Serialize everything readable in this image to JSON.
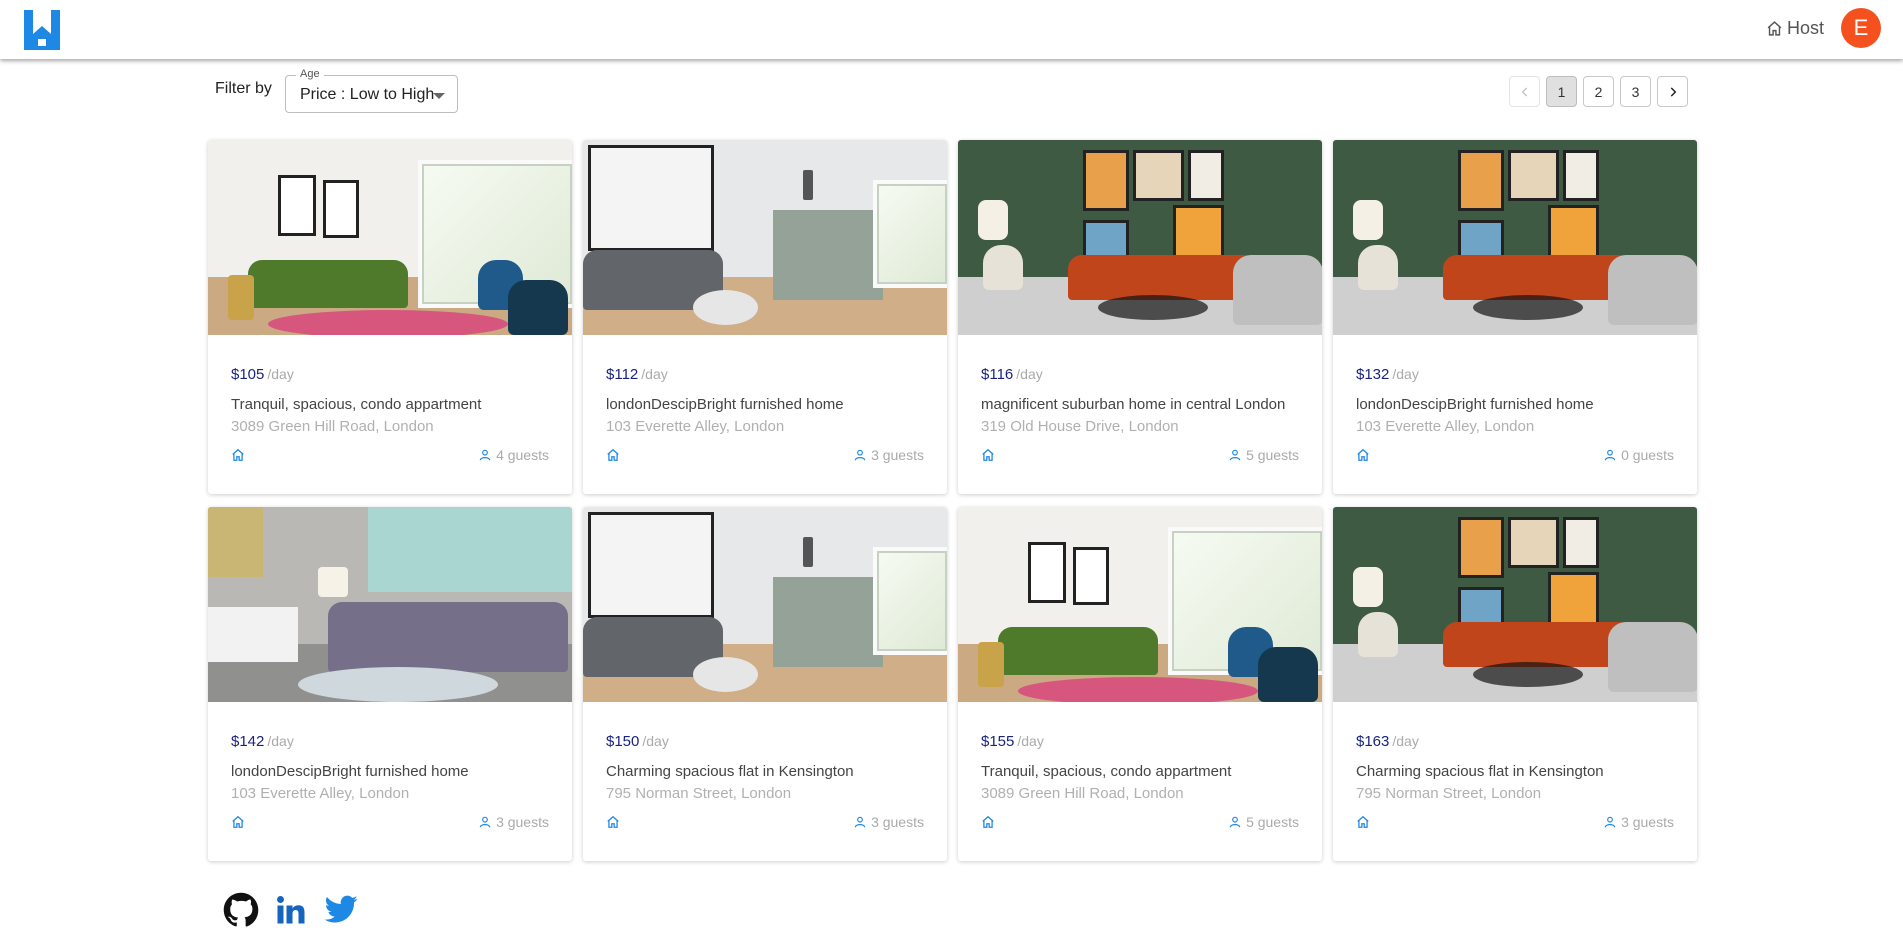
{
  "header": {
    "host_label": "Host",
    "avatar_initial": "E"
  },
  "filter": {
    "label": "Filter by",
    "legend": "Age",
    "value": "Price : Low to High"
  },
  "pagination": {
    "pages": [
      "1",
      "2",
      "3"
    ],
    "current": "1"
  },
  "listings": [
    {
      "price": "$105",
      "per": "/day",
      "title": "Tranquil, spacious, condo appartment",
      "address": "3089 Green Hill Road, London",
      "guests": "4 guests",
      "image": "green-sofa-room"
    },
    {
      "price": "$112",
      "per": "/day",
      "title": "londonDescipBright furnished home",
      "address": "103 Everette Alley, London",
      "guests": "3 guests",
      "image": "kitchen-grey-sofa"
    },
    {
      "price": "$116",
      "per": "/day",
      "title": "magnificent suburban home in central London",
      "address": "319 Old House Drive, London",
      "guests": "5 guests",
      "image": "orange-sofa-green-wall"
    },
    {
      "price": "$132",
      "per": "/day",
      "title": "londonDescipBright furnished home",
      "address": "103 Everette Alley, London",
      "guests": "0 guests",
      "image": "orange-sofa-green-wall"
    },
    {
      "price": "$142",
      "per": "/day",
      "title": "londonDescipBright furnished home",
      "address": "103 Everette Alley, London",
      "guests": "3 guests",
      "image": "grey-sofa-concrete-wall"
    },
    {
      "price": "$150",
      "per": "/day",
      "title": "Charming spacious flat in Kensington",
      "address": "795 Norman Street, London",
      "guests": "3 guests",
      "image": "kitchen-grey-sofa"
    },
    {
      "price": "$155",
      "per": "/day",
      "title": "Tranquil, spacious, condo appartment",
      "address": "3089 Green Hill Road, London",
      "guests": "5 guests",
      "image": "green-sofa-room"
    },
    {
      "price": "$163",
      "per": "/day",
      "title": "Charming spacious flat in Kensington",
      "address": "795 Norman Street, London",
      "guests": "3 guests",
      "image": "orange-sofa-green-wall"
    }
  ],
  "social": [
    "github-icon",
    "linkedin-icon",
    "twitter-icon"
  ],
  "colors": {
    "brand": "#1e88e5",
    "avatar": "#f4511e",
    "price": "#1a237e"
  }
}
